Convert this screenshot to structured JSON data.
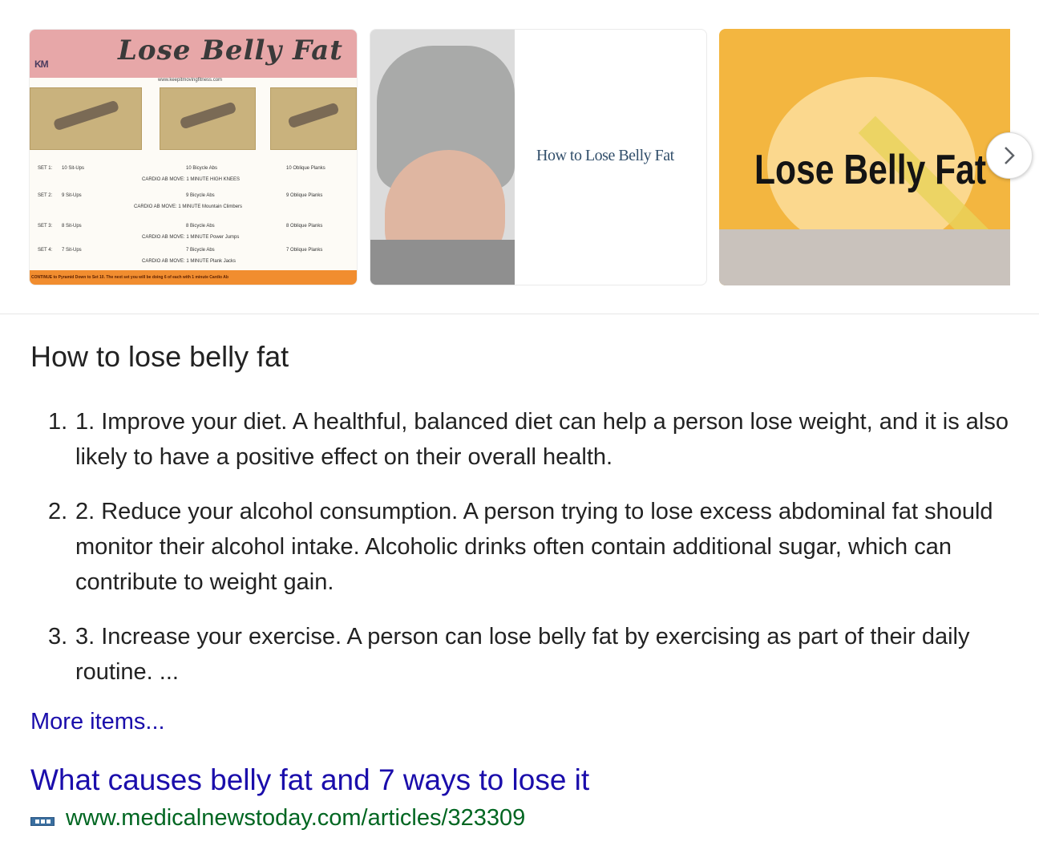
{
  "images": {
    "thumb1": {
      "logo": "KM",
      "title": "Lose Belly Fat",
      "url": "www.keepitmovingfitness.com",
      "rows": [
        {
          "set": "SET 1:",
          "a": "10 Sit-Ups",
          "b": "10 Bicycle Abs",
          "c": "10 Oblique Planks",
          "cardio": "CARDIO AB MOVE: 1 MINUTE HIGH KNEES"
        },
        {
          "set": "SET 2:",
          "a": "9 Sit-Ups",
          "b": "9 Bicycle Abs",
          "c": "9 Oblique Planks",
          "cardio": "CARDIO AB MOVE: 1 MINUTE Mountain Climbers"
        },
        {
          "set": "SET 3:",
          "a": "8 Sit-Ups",
          "b": "8 Bicycle Abs",
          "c": "8 Oblique Planks",
          "cardio": "CARDIO AB MOVE: 1 MINUTE Power Jumps"
        },
        {
          "set": "SET 4:",
          "a": "7 Sit-Ups",
          "b": "7 Bicycle Abs",
          "c": "7 Oblique Planks",
          "cardio": "CARDIO AB MOVE: 1 MINUTE Plank Jacks"
        }
      ],
      "footer": "CONTINUE to Pyramid Down to Set 10. The next set you will be doing 6 of each with 1 minute Cardio Ab"
    },
    "thumb2": {
      "caption": "How to Lose Belly Fat"
    },
    "thumb3": {
      "caption": "Lose Belly Fat"
    },
    "next_icon": "chevron-right-icon"
  },
  "snippet": {
    "heading": "How to lose belly fat",
    "steps": [
      {
        "num": "1.",
        "text": "1. Improve your diet. A healthful, balanced diet can help a person lose weight, and it is also likely to have a positive effect on their overall health."
      },
      {
        "num": "2.",
        "text": "2. Reduce your alcohol consumption. A person trying to lose excess abdominal fat should monitor their alcohol intake. Alcoholic drinks often contain additional sugar, which can contribute to weight gain."
      },
      {
        "num": "3.",
        "text": "3. Increase your exercise. A person can lose belly fat by exercising as part of their daily routine. ..."
      }
    ],
    "more": "More items...",
    "result_title": "What causes belly fat and 7 ways to lose it",
    "favicon_icon": "mnt-favicon-icon",
    "url": "www.medicalnewstoday.com/articles/323309"
  },
  "colors": {
    "link": "#1a0dab",
    "url": "#006621",
    "text": "#222222"
  }
}
